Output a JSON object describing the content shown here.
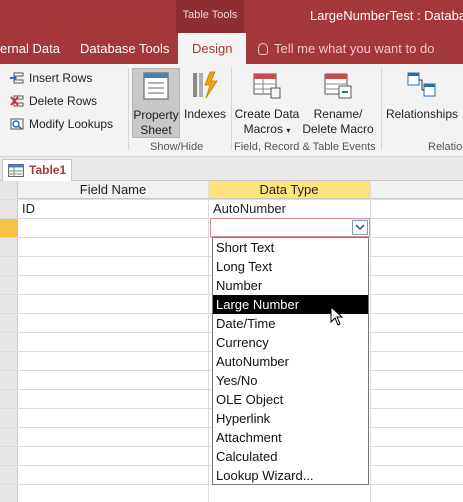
{
  "titlebar": {
    "context_tools": "Table Tools",
    "app_title": "LargeNumberTest : Database"
  },
  "tabs": [
    {
      "label": "ernal Data"
    },
    {
      "label": "Database Tools"
    },
    {
      "label": "Design",
      "active": true
    }
  ],
  "tellme": "Tell me what you want to do",
  "ribbon": {
    "tools": {
      "insert_rows": "Insert Rows",
      "delete_rows": "Delete Rows",
      "modify_lookups": "Modify Lookups"
    },
    "show_hide": {
      "property_sheet_line1": "Property",
      "property_sheet_line2": "Sheet",
      "indexes": "Indexes",
      "group_label": "Show/Hide"
    },
    "events": {
      "create_macros_line1": "Create Data",
      "create_macros_line2": "Macros",
      "rename_macro_line1": "Rename/",
      "rename_macro_line2": "Delete Macro",
      "group_label": "Field, Record & Table Events"
    },
    "relationships": {
      "relationships": "Relationships",
      "group_label": "Relatio"
    }
  },
  "object_tab": {
    "label": "Table1"
  },
  "grid": {
    "headers": {
      "field_name": "Field Name",
      "data_type": "Data Type"
    },
    "rows": [
      {
        "field_name": "ID",
        "data_type": "AutoNumber"
      }
    ]
  },
  "dropdown": {
    "selected_index": 3,
    "options": [
      "Short Text",
      "Long Text",
      "Number",
      "Large Number",
      "Date/Time",
      "Currency",
      "AutoNumber",
      "Yes/No",
      "OLE Object",
      "Hyperlink",
      "Attachment",
      "Calculated",
      "Lookup Wizard..."
    ]
  },
  "colors": {
    "accent": "#a4373a",
    "ribbon_bg": "#f3f3f3",
    "header_highlight": "#fbe47b",
    "row_highlight": "#f5c542",
    "selected_option": "#000000"
  }
}
